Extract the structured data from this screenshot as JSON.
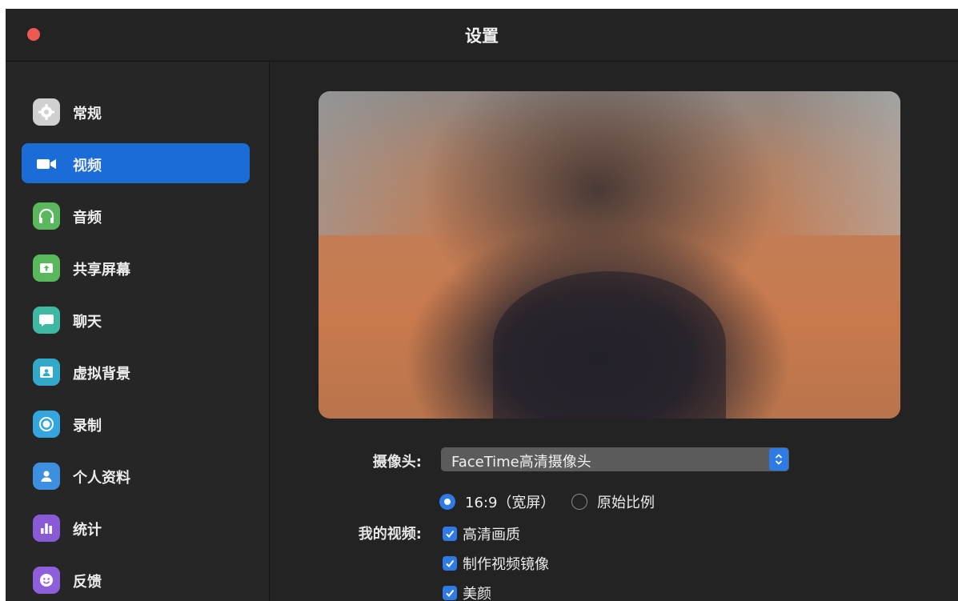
{
  "window": {
    "title": "设置"
  },
  "sidebar": {
    "items": [
      {
        "label": "常规",
        "icon": "gear-icon",
        "color": "#d0d0d0",
        "active": false
      },
      {
        "label": "视频",
        "icon": "video-camera-icon",
        "color": "#1a6dd6",
        "active": true
      },
      {
        "label": "音频",
        "icon": "headphones-icon",
        "color": "#59b85c",
        "active": false
      },
      {
        "label": "共享屏幕",
        "icon": "share-screen-icon",
        "color": "#59b85c",
        "active": false
      },
      {
        "label": "聊天",
        "icon": "chat-bubble-icon",
        "color": "#3fb8a3",
        "active": false
      },
      {
        "label": "虚拟背景",
        "icon": "virtual-background-icon",
        "color": "#33a9c9",
        "active": false
      },
      {
        "label": "录制",
        "icon": "record-icon",
        "color": "#33a6df",
        "active": false
      },
      {
        "label": "个人资料",
        "icon": "profile-icon",
        "color": "#3d8fe0",
        "active": false
      },
      {
        "label": "统计",
        "icon": "statistics-icon",
        "color": "#8a5ad6",
        "active": false
      },
      {
        "label": "反馈",
        "icon": "feedback-icon",
        "color": "#8e5fdb",
        "active": false
      }
    ]
  },
  "video": {
    "camera_label": "摄像头:",
    "camera_value": "FaceTime高清摄像头",
    "aspect": {
      "wide_label": "16:9（宽屏）",
      "original_label": "原始比例",
      "selected": "wide"
    },
    "my_video_label": "我的视频:",
    "options": [
      {
        "label": "高清画质",
        "checked": true
      },
      {
        "label": "制作视频镜像",
        "checked": true
      },
      {
        "label": "美颜",
        "checked": true
      }
    ]
  },
  "colors": {
    "accent": "#1a6dd6",
    "close": "#ec5a52",
    "background": "#232323"
  }
}
